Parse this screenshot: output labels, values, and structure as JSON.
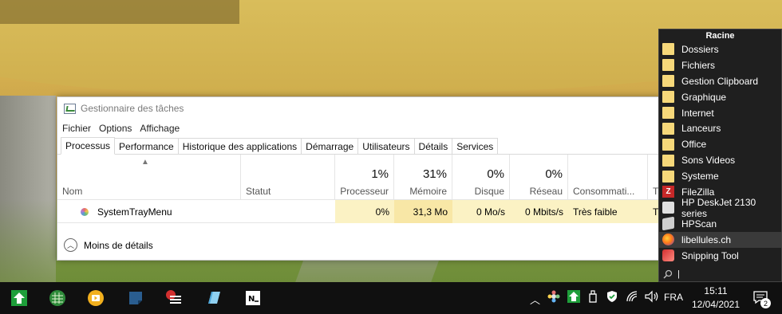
{
  "task_manager": {
    "title": "Gestionnaire des tâches",
    "menu": [
      "Fichier",
      "Options",
      "Affichage"
    ],
    "tabs": [
      "Processus",
      "Performance",
      "Historique des applications",
      "Démarrage",
      "Utilisateurs",
      "Détails",
      "Services"
    ],
    "active_tab": "Processus",
    "columns": {
      "name": "Nom",
      "status": "Statut",
      "cpu": {
        "pct": "1%",
        "label": "Processeur"
      },
      "memory": {
        "pct": "31%",
        "label": "Mémoire"
      },
      "disk": {
        "pct": "0%",
        "label": "Disque"
      },
      "network": {
        "pct": "0%",
        "label": "Réseau"
      },
      "power": "Consommati...",
      "trend": "T"
    },
    "row": {
      "name": "SystemTrayMenu",
      "cpu": "0%",
      "memory": "31,3 Mo",
      "disk": "0 Mo/s",
      "network": "0 Mbits/s",
      "power": "Très faible",
      "trend": "Tr"
    },
    "footer": "Moins de détails"
  },
  "tray_menu": {
    "header": "Racine",
    "items": [
      {
        "label": "Dossiers",
        "icon": "folder-icon"
      },
      {
        "label": "Fichiers",
        "icon": "folder-icon"
      },
      {
        "label": "Gestion Clipboard",
        "icon": "folder-icon"
      },
      {
        "label": "Graphique",
        "icon": "folder-icon"
      },
      {
        "label": "Internet",
        "icon": "folder-icon"
      },
      {
        "label": "Lanceurs",
        "icon": "folder-icon"
      },
      {
        "label": "Office",
        "icon": "folder-icon"
      },
      {
        "label": "Sons Videos",
        "icon": "folder-icon"
      },
      {
        "label": "Systeme",
        "icon": "folder-icon"
      },
      {
        "label": "FileZilla",
        "icon": "filezilla-icon"
      },
      {
        "label": "HP DeskJet 2130 series",
        "icon": "printer-icon"
      },
      {
        "label": "HPScan",
        "icon": "scanner-icon"
      },
      {
        "label": "libellules.ch",
        "icon": "firefox-icon"
      },
      {
        "label": "Snipping Tool",
        "icon": "snipping-tool-icon"
      }
    ],
    "search_cursor": "|"
  },
  "taskbar": {
    "language": "FRA",
    "time": "15:11",
    "date": "12/04/2021",
    "notifications": "2",
    "pinned_icons": [
      "green-up-arrow-icon",
      "spreadsheet-icon",
      "media-player-icon",
      "sticky-note-icon",
      "red-list-icon",
      "notepad-icon",
      "notes-app-icon"
    ]
  }
}
